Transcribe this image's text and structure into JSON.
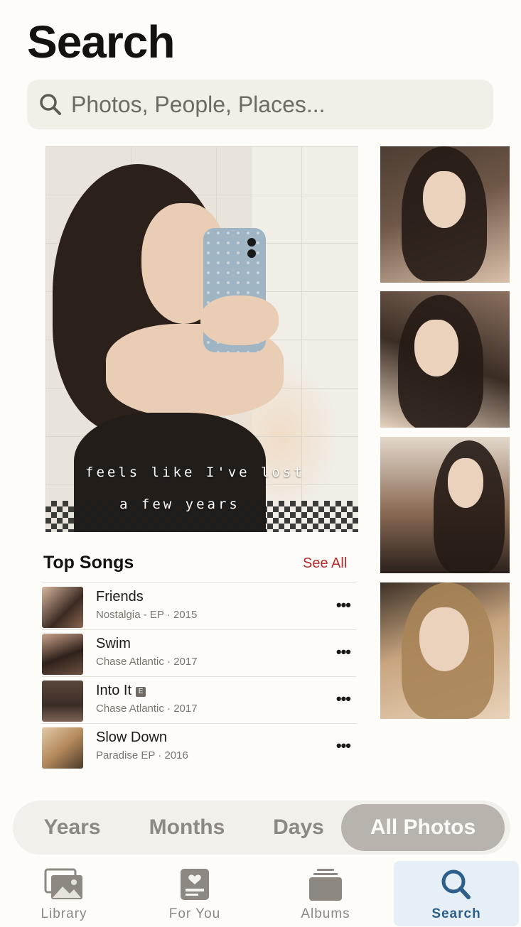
{
  "header": {
    "title": "Search"
  },
  "search": {
    "placeholder": "Photos, People, Places..."
  },
  "featured_photo": {
    "caption_line1": "feels  like  I've  lost",
    "caption_line2": "a  few  years"
  },
  "top_songs": {
    "title": "Top Songs",
    "see_all": "See All",
    "items": [
      {
        "name": "Friends",
        "subtitle": "Nostalgia - EP · 2015",
        "explicit": false
      },
      {
        "name": "Swim",
        "subtitle": "Chase Atlantic · 2017",
        "explicit": false
      },
      {
        "name": "Into It",
        "subtitle": "Chase Atlantic · 2017",
        "explicit": true,
        "explicit_mark": "E"
      },
      {
        "name": "Slow Down",
        "subtitle": "Paradise EP · 2016",
        "explicit": false
      }
    ],
    "more_label": "•••"
  },
  "segments": [
    {
      "label": "Years"
    },
    {
      "label": "Months"
    },
    {
      "label": "Days"
    },
    {
      "label": "All Photos",
      "active": true
    }
  ],
  "tabs": [
    {
      "label": "Library",
      "icon": "photo-library-icon"
    },
    {
      "label": "For You",
      "icon": "for-you-icon"
    },
    {
      "label": "Albums",
      "icon": "albums-icon"
    },
    {
      "label": "Search",
      "icon": "search-icon",
      "active": true
    }
  ],
  "colors": {
    "accent_red": "#b52a2a",
    "active_tab": "#2e5f8b",
    "background": "#fdfcf8"
  }
}
